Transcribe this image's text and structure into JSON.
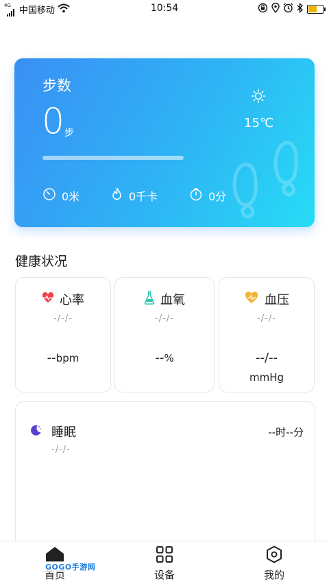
{
  "status_bar": {
    "network_label": "4G",
    "carrier": "中国移动",
    "time": "10:54",
    "battery_level": 0.55
  },
  "hero": {
    "title": "步数",
    "steps": "0",
    "steps_unit": "步",
    "progress": 0,
    "temperature": "15℃",
    "weather_icon": "sun-icon",
    "distance": "0米",
    "calories": "0千卡",
    "duration": "0分"
  },
  "health": {
    "title": "健康状况",
    "heart_rate": {
      "label": "心率",
      "date": "-/-/-",
      "value": "--",
      "unit": "bpm"
    },
    "blood_oxygen": {
      "label": "血氧",
      "date": "-/-/-",
      "value": "--",
      "unit": "%"
    },
    "blood_pressure": {
      "label": "血压",
      "date": "-/-/-",
      "value": "--/--",
      "unit": "mmHg"
    }
  },
  "sleep": {
    "label": "睡眠",
    "date": "-/-/-",
    "duration": "--时--分"
  },
  "bottom_nav": {
    "home": "首页",
    "devices": "设备",
    "mine": "我的"
  },
  "watermark": "GOGO手游网",
  "colors": {
    "hero_start": "#3a8ff5",
    "hero_end": "#27dcf5",
    "heart": "#f0404d",
    "oxygen": "#2fc6b0",
    "pressure": "#f2b53a",
    "sleep": "#5b3fd0"
  }
}
